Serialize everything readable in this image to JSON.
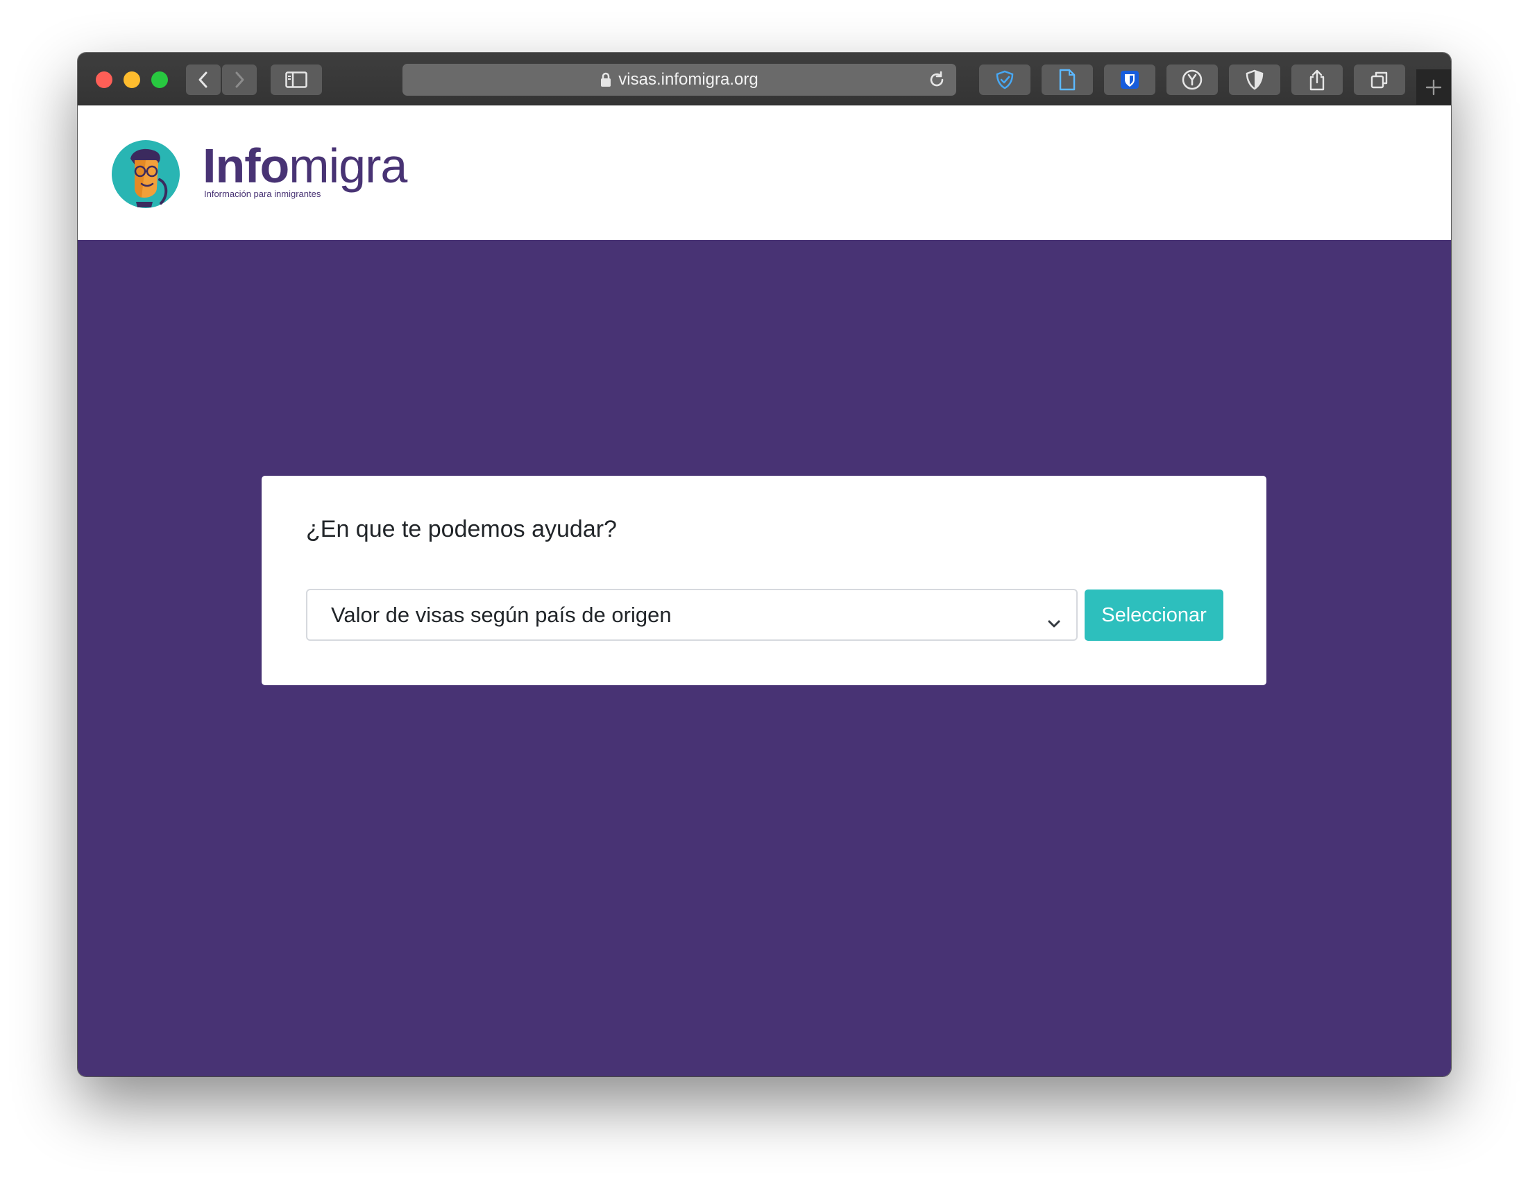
{
  "browser": {
    "url": "visas.infomigra.org",
    "icons": [
      "back-icon",
      "forward-icon",
      "sidebar-icon",
      "lock-icon",
      "reload-icon",
      "shield-check-extension-icon",
      "document-extension-icon",
      "bitwarden-extension-icon",
      "y-extension-icon",
      "half-shield-extension-icon",
      "share-icon",
      "tabs-icon",
      "new-tab-plus-icon"
    ]
  },
  "header": {
    "logo_bold": "Info",
    "logo_light": "migra",
    "tagline": "Información para inmigrantes"
  },
  "main": {
    "question": "¿En que te podemos ayudar?",
    "select_value": "Valor de visas según país de origen",
    "submit_label": "Seleccionar"
  },
  "colors": {
    "brand_purple": "#483374",
    "accent_teal": "#2dbfbd"
  }
}
